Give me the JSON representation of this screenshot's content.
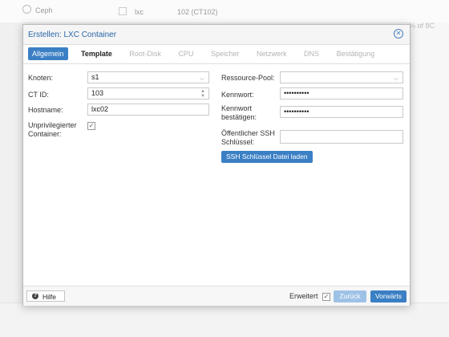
{
  "background": {
    "tree_item": "Ceph",
    "row_type": "lxc",
    "row_id": "102 (CT102)",
    "right_fragment": "% of 8C"
  },
  "dialog": {
    "title": "Erstellen: LXC Container",
    "tabs": [
      {
        "label": "Allgemein",
        "state": "active"
      },
      {
        "label": "Template",
        "state": "enabled"
      },
      {
        "label": "Root-Disk",
        "state": "disabled"
      },
      {
        "label": "CPU",
        "state": "disabled"
      },
      {
        "label": "Speicher",
        "state": "disabled"
      },
      {
        "label": "Netzwerk",
        "state": "disabled"
      },
      {
        "label": "DNS",
        "state": "disabled"
      },
      {
        "label": "Bestätigung",
        "state": "disabled"
      }
    ],
    "form": {
      "knoten_label": "Knoten:",
      "knoten_value": "s1",
      "ctid_label": "CT ID:",
      "ctid_value": "103",
      "hostname_label": "Hostname:",
      "hostname_value": "lxc02",
      "unpriv_label_1": "Unprivilegierter",
      "unpriv_label_2": "Container:",
      "unpriv_checked": "✓",
      "pool_label": "Ressource-Pool:",
      "pool_value": "",
      "kennwort_label": "Kennwort:",
      "kennwort_value": "••••••••••",
      "kennwort2_label_1": "Kennwort",
      "kennwort2_label_2": "bestätigen:",
      "kennwort2_value": "••••••••••",
      "ssh_label_1": "Öffentlicher SSH",
      "ssh_label_2": "Schlüssel:",
      "ssh_value": "",
      "ssh_button": "SSH Schlüssel Datei laden"
    },
    "footer": {
      "hilfe": "Hilfe",
      "erweitert": "Erweitert",
      "erweitert_checked": "✓",
      "zurueck": "Zurück",
      "vorwaerts": "Vorwärts"
    }
  },
  "colors": {
    "accent": "#3b7fc4",
    "title_text": "#2a66a8"
  }
}
